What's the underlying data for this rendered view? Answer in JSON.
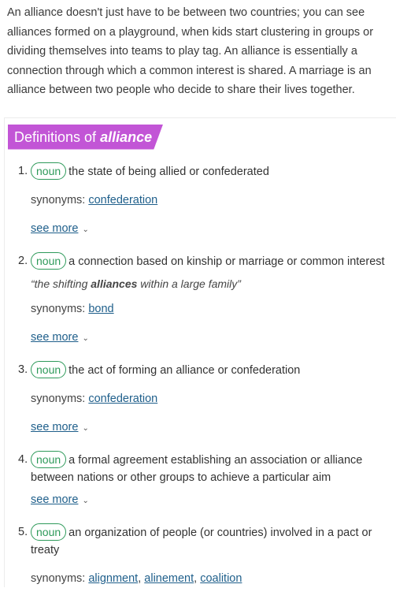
{
  "intro_text": "An alliance doesn't just have to be between two countries; you can see alliances formed on a playground, when kids start clustering in groups or dividing themselves into teams to play tag. An alliance is essentially a connection through which a common interest is shared. A marriage is an alliance between two people who decide to share their lives together.",
  "definitions": {
    "heading_prefix": "Definitions of",
    "heading_word": "alliance",
    "see_more_label": "see more",
    "synonyms_label": "synonyms:",
    "items": [
      {
        "num": "1.",
        "pos": "noun",
        "text": "the state of being allied or confederated",
        "synonyms": [
          "confederation"
        ]
      },
      {
        "num": "2.",
        "pos": "noun",
        "text": "a connection based on kinship or marriage or common interest",
        "example_before": "“the shifting ",
        "example_bold": "alliances",
        "example_after": " within a large family”",
        "synonyms": [
          "bond"
        ]
      },
      {
        "num": "3.",
        "pos": "noun",
        "text": "the act of forming an alliance or confederation",
        "synonyms": [
          "confederation"
        ]
      },
      {
        "num": "4.",
        "pos": "noun",
        "text": "a formal agreement establishing an association or alliance between nations or other groups to achieve a particular aim"
      },
      {
        "num": "5.",
        "pos": "noun",
        "text": "an organization of people (or countries) involved in a pact or treaty",
        "synonyms": [
          "alignment",
          "alinement",
          "coalition"
        ]
      }
    ]
  }
}
